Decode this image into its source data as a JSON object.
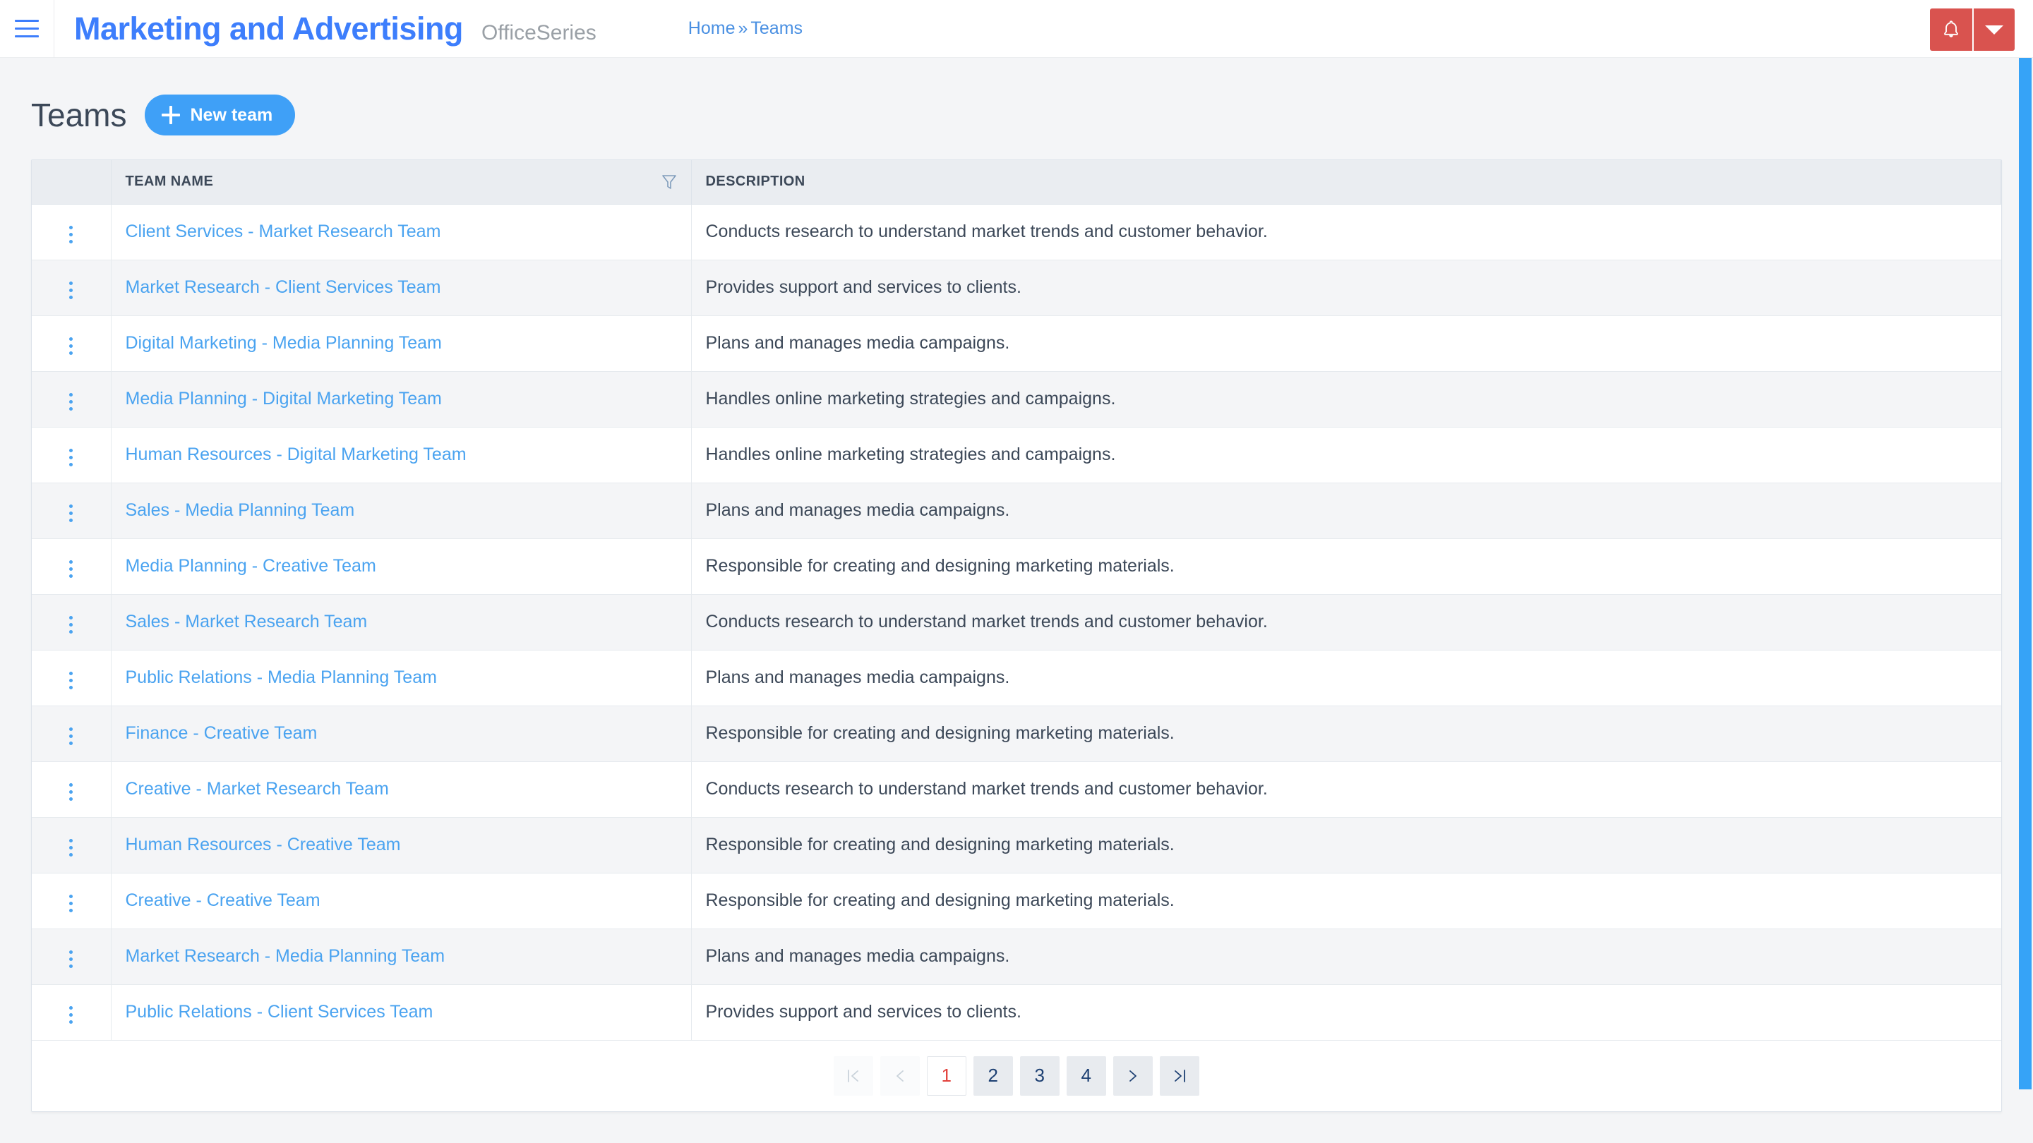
{
  "topbar": {
    "menu_icon": "hamburger-icon",
    "brand_title": "Marketing and Advertising",
    "brand_subtitle": "OfficeSeries",
    "breadcrumb": {
      "home": "Home",
      "separator": "»",
      "current": "Teams"
    },
    "notification_icon": "bell-icon",
    "dropdown_icon": "caret-down-icon",
    "accent_red": "#d9534f",
    "brand_blue": "#3d7efc"
  },
  "page": {
    "title": "Teams",
    "new_button_label": "New team",
    "new_button_icon": "plus-icon",
    "new_button_color": "#3fa0f7"
  },
  "table": {
    "columns": [
      {
        "key": "kebab",
        "label": ""
      },
      {
        "key": "name",
        "label": "TEAM NAME",
        "filter_icon": "filter-funnel-icon"
      },
      {
        "key": "description",
        "label": "DESCRIPTION"
      }
    ],
    "row_action_icon": "kebab-menu-icon",
    "link_color": "#4aa3f0",
    "rows": [
      {
        "name": "Client Services - Market Research Team",
        "description": "Conducts research to understand market trends and customer behavior."
      },
      {
        "name": "Market Research - Client Services Team",
        "description": "Provides support and services to clients."
      },
      {
        "name": "Digital Marketing - Media Planning Team",
        "description": "Plans and manages media campaigns."
      },
      {
        "name": "Media Planning - Digital Marketing Team",
        "description": "Handles online marketing strategies and campaigns."
      },
      {
        "name": "Human Resources - Digital Marketing Team",
        "description": "Handles online marketing strategies and campaigns."
      },
      {
        "name": "Sales - Media Planning Team",
        "description": "Plans and manages media campaigns."
      },
      {
        "name": "Media Planning - Creative Team",
        "description": "Responsible for creating and designing marketing materials."
      },
      {
        "name": "Sales - Market Research Team",
        "description": "Conducts research to understand market trends and customer behavior."
      },
      {
        "name": "Public Relations - Media Planning Team",
        "description": "Plans and manages media campaigns."
      },
      {
        "name": "Finance - Creative Team",
        "description": "Responsible for creating and designing marketing materials."
      },
      {
        "name": "Creative - Market Research Team",
        "description": "Conducts research to understand market trends and customer behavior."
      },
      {
        "name": "Human Resources - Creative Team",
        "description": "Responsible for creating and designing marketing materials."
      },
      {
        "name": "Creative - Creative Team",
        "description": "Responsible for creating and designing marketing materials."
      },
      {
        "name": "Market Research - Media Planning Team",
        "description": "Plans and manages media campaigns."
      },
      {
        "name": "Public Relations - Client Services Team",
        "description": "Provides support and services to clients."
      }
    ]
  },
  "pagination": {
    "first_icon": "first-page-icon",
    "prev_icon": "prev-page-icon",
    "next_icon": "next-page-icon",
    "last_icon": "last-page-icon",
    "pages": [
      "1",
      "2",
      "3",
      "4"
    ],
    "active_page": "1",
    "active_color": "#e2413c"
  }
}
